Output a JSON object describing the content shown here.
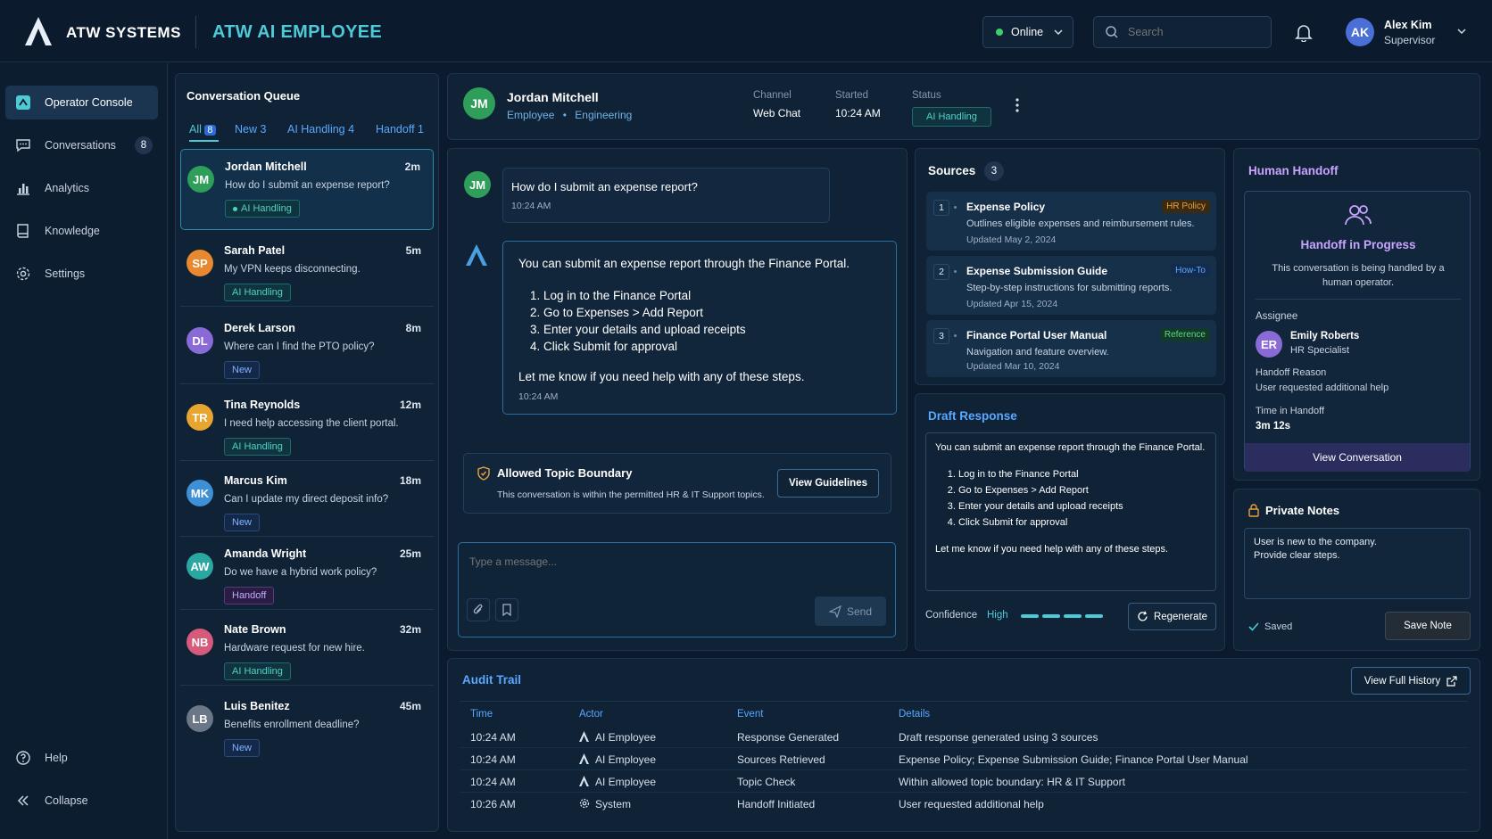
{
  "brand": {
    "name": "ATW SYSTEMS",
    "product": "ATW AI EMPLOYEE"
  },
  "header": {
    "status": "Online",
    "search_placeholder": "Search",
    "user": {
      "initials": "AK",
      "name": "Alex Kim",
      "role": "Supervisor"
    }
  },
  "sidebar": {
    "items": [
      {
        "label": "Operator Console",
        "icon": "console-icon"
      },
      {
        "label": "Conversations",
        "icon": "chat-icon",
        "count": "8"
      },
      {
        "label": "Analytics",
        "icon": "chart-icon"
      },
      {
        "label": "Knowledge",
        "icon": "book-icon"
      },
      {
        "label": "Settings",
        "icon": "gear-icon"
      }
    ],
    "help": "Help",
    "collapse": "Collapse"
  },
  "queue": {
    "title": "Conversation Queue",
    "tabs": [
      {
        "label": "All",
        "count": "8"
      },
      {
        "label": "New",
        "count": "3"
      },
      {
        "label": "AI Handling",
        "count": "4"
      },
      {
        "label": "Handoff",
        "count": "1"
      }
    ],
    "items": [
      {
        "initials": "JM",
        "color": "#2f9e5a",
        "name": "Jordan Mitchell",
        "time": "2m",
        "message": "How do I submit an expense report?",
        "tag": "AI Handling",
        "tag_type": "ai"
      },
      {
        "initials": "SP",
        "color": "#e8892f",
        "name": "Sarah Patel",
        "time": "5m",
        "message": "My VPN keeps disconnecting.",
        "tag": "AI Handling",
        "tag_type": "ai"
      },
      {
        "initials": "DL",
        "color": "#8a6ad6",
        "name": "Derek Larson",
        "time": "8m",
        "message": "Where can I find the PTO policy?",
        "tag": "New",
        "tag_type": "new"
      },
      {
        "initials": "TR",
        "color": "#e8a52f",
        "name": "Tina Reynolds",
        "time": "12m",
        "message": "I need help accessing the client portal.",
        "tag": "AI Handling",
        "tag_type": "ai"
      },
      {
        "initials": "MK",
        "color": "#3d8fd6",
        "name": "Marcus Kim",
        "time": "18m",
        "message": "Can I update my direct deposit info?",
        "tag": "New",
        "tag_type": "new"
      },
      {
        "initials": "AW",
        "color": "#2aa7a0",
        "name": "Amanda Wright",
        "time": "25m",
        "message": "Do we have a hybrid work policy?",
        "tag": "Handoff",
        "tag_type": "hand"
      },
      {
        "initials": "NB",
        "color": "#d65a7a",
        "name": "Nate Brown",
        "time": "32m",
        "message": "Hardware request for new hire.",
        "tag": "AI Handling",
        "tag_type": "ai"
      },
      {
        "initials": "LB",
        "color": "#6b7686",
        "name": "Luis Benitez",
        "time": "45m",
        "message": "Benefits enrollment deadline?",
        "tag": "New",
        "tag_type": "new"
      }
    ]
  },
  "conversation": {
    "initials": "JM",
    "name": "Jordan Mitchell",
    "role": "Employee",
    "department": "Engineering",
    "channel_label": "Channel",
    "channel": "Web Chat",
    "started_label": "Started",
    "started": "10:24 AM",
    "status_label": "Status",
    "status": "AI Handling",
    "user_message": "How do I submit an expense report?",
    "user_time": "10:24 AM",
    "ai_intro": "You can submit an expense report through the Finance Portal.",
    "ai_steps": [
      "Log in to the Finance Portal",
      "Go to Expenses > Add Report",
      "Enter your details and upload receipts",
      "Click Submit for approval"
    ],
    "ai_outro": "Let me know if you need help with any of these steps.",
    "ai_time": "10:24 AM",
    "boundary_title": "Allowed Topic Boundary",
    "boundary_text": "This conversation is within the permitted HR & IT Support topics.",
    "boundary_button": "View Guidelines",
    "input_placeholder": "Type a message...",
    "send": "Send"
  },
  "sources": {
    "title": "Sources",
    "count": "3",
    "items": [
      {
        "num": "1",
        "title": "Expense Policy",
        "tag": "HR Policy",
        "tag_color": "#e8a23a",
        "desc": "Outlines eligible expenses and reimbursement rules.",
        "updated": "Updated May 2, 2024"
      },
      {
        "num": "2",
        "title": "Expense Submission Guide",
        "tag": "How-To",
        "tag_color": "#5aa8ff",
        "desc": "Step-by-step instructions for submitting reports.",
        "updated": "Updated Apr 15, 2024"
      },
      {
        "num": "3",
        "title": "Finance Portal User Manual",
        "tag": "Reference",
        "tag_color": "#5fd38a",
        "desc": "Navigation and feature overview.",
        "updated": "Updated Mar 10, 2024"
      }
    ]
  },
  "draft": {
    "title": "Draft Response",
    "intro": "You can submit an expense report through the Finance Portal.",
    "steps": [
      "Log in to the Finance Portal",
      "Go to Expenses > Add Report",
      "Enter your details and upload receipts",
      "Click Submit for approval"
    ],
    "outro": "Let me know if you need help with any of these steps.",
    "confidence_label": "Confidence",
    "confidence": "High",
    "regenerate": "Regenerate"
  },
  "handoff": {
    "title": "Human Handoff",
    "state_title": "Handoff in Progress",
    "state_text": "This conversation is being handled by a human operator.",
    "assignee_label": "Assignee",
    "assignee_initials": "ER",
    "assignee_name": "Emily Roberts",
    "assignee_role": "HR Specialist",
    "reason_label": "Handoff Reason",
    "reason": "User requested additional help",
    "time_label": "Time in Handoff",
    "time": "3m 12s",
    "button": "View Conversation"
  },
  "notes": {
    "title": "Private Notes",
    "text_line1": "User is new to the company.",
    "text_line2": "Provide clear steps.",
    "saved": "Saved",
    "save_button": "Save Note"
  },
  "audit": {
    "title": "Audit Trail",
    "button": "View Full History",
    "columns": [
      "Time",
      "Actor",
      "Event",
      "Details"
    ],
    "rows": [
      {
        "time": "10:24 AM",
        "actor": "AI Employee",
        "event": "Response Generated",
        "details": "Draft response generated using 3 sources"
      },
      {
        "time": "10:24 AM",
        "actor": "AI Employee",
        "event": "Sources Retrieved",
        "details": "Expense Policy; Expense Submission Guide; Finance Portal User Manual"
      },
      {
        "time": "10:24 AM",
        "actor": "AI Employee",
        "event": "Topic Check",
        "details": "Within allowed topic boundary: HR & IT Support"
      },
      {
        "time": "10:26 AM",
        "actor": "System",
        "event": "Handoff Initiated",
        "details": "User requested additional help"
      }
    ]
  }
}
